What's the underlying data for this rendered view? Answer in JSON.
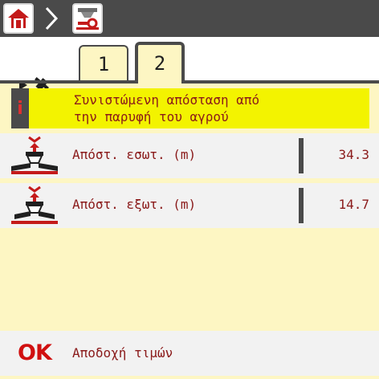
{
  "nav": {
    "home_icon": "home-icon",
    "separator_icon": "chevron-right-icon",
    "service_icon": "spreader-wrench-icon"
  },
  "side_icons": [
    "gps-satellite-icon",
    "boom-border-icon"
  ],
  "tabs": [
    {
      "label": "1",
      "active": false
    },
    {
      "label": "2",
      "active": true
    }
  ],
  "info": {
    "badge": "i",
    "text": "Συνιστώμενη απόσταση από\nτην παρυφή του αγρού"
  },
  "rows": [
    {
      "icon": "inner-distance-icon",
      "label": "Απόστ. εσωτ. (m)",
      "value": "34.3"
    },
    {
      "icon": "outer-distance-icon",
      "label": "Απόστ. εξωτ. (m)",
      "value": "14.7"
    }
  ],
  "ok": {
    "mark": "OK",
    "label": "Αποδοχή τιμών"
  },
  "colors": {
    "background": "#fdf6c3",
    "header": "#4a4a4a",
    "info_highlight": "#f3f300",
    "text": "#8a1a1a",
    "ok_red": "#d01010"
  }
}
